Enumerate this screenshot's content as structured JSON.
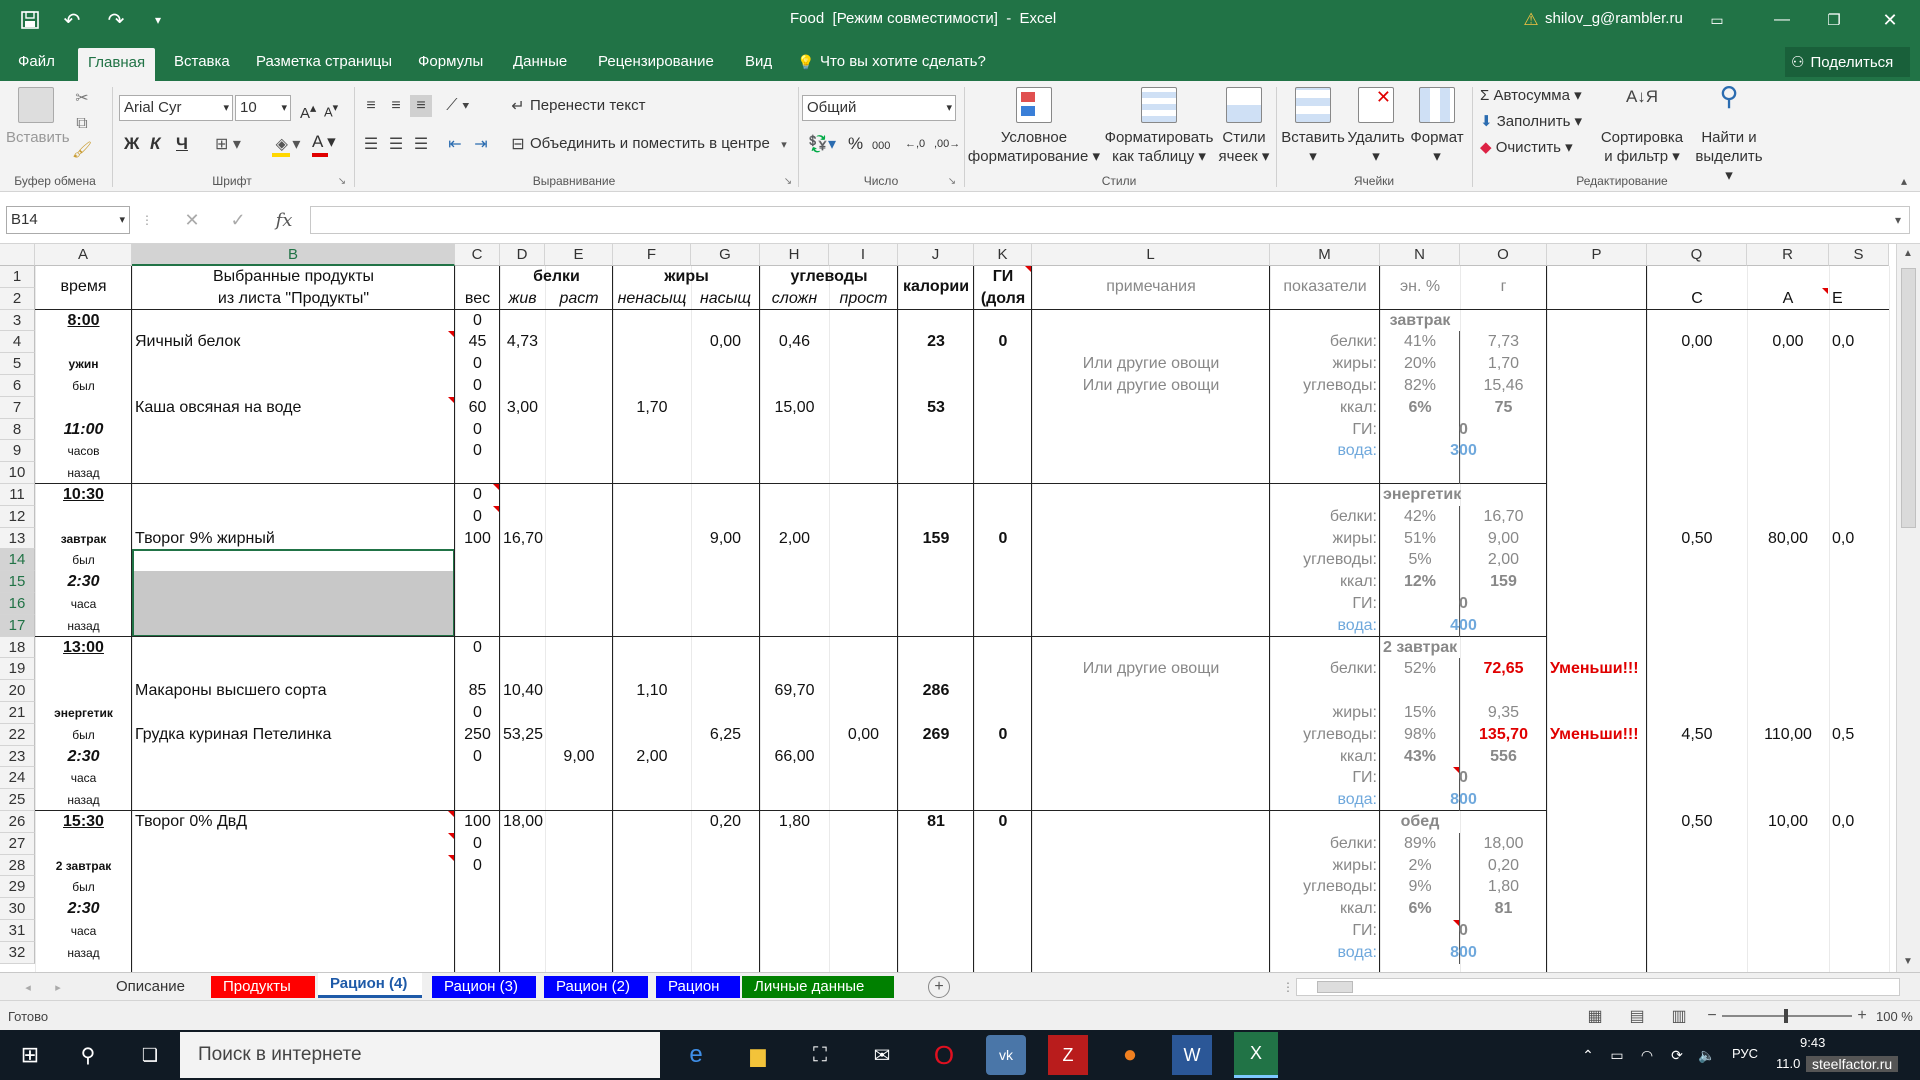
{
  "title": {
    "file": "Food  [Режим совместимости]  -  Excel",
    "user": "shilov_g@rambler.ru"
  },
  "tabs": [
    "Файл",
    "Главная",
    "Вставка",
    "Разметка страницы",
    "Формулы",
    "Данные",
    "Рецензирование",
    "Вид"
  ],
  "tell_me": "Что вы хотите сделать?",
  "share": "Поделиться",
  "ribbon": {
    "paste": "Вставить",
    "font_name": "Arial Cyr",
    "font_size": "10",
    "bold": "Ж",
    "italic": "К",
    "underline": "Ч",
    "wrap": "Перенести текст",
    "merge": "Объединить и поместить в центре",
    "num_format": "Общий",
    "cond1": "Условное",
    "cond2": "форматирование",
    "fmt1": "Форматировать",
    "fmt2": "как таблицу",
    "sty1": "Стили",
    "sty2": "ячеек",
    "ins": "Вставить",
    "del": "Удалить",
    "fmt": "Формат",
    "autosum": "Автосумма",
    "fill": "Заполнить",
    "clear": "Очистить",
    "sort1": "Сортировка",
    "sort2": "и фильтр",
    "find1": "Найти и",
    "find2": "выделить",
    "groups": [
      "Буфер обмена",
      "Шрифт",
      "Выравнивание",
      "Число",
      "Стили",
      "Ячейки",
      "Редактирование"
    ]
  },
  "namebox": "B14",
  "columns": [
    "A",
    "B",
    "C",
    "D",
    "E",
    "F",
    "G",
    "H",
    "I",
    "J",
    "K",
    "L",
    "M",
    "N",
    "O",
    "P",
    "Q",
    "R",
    "S"
  ],
  "rows": [
    "1",
    "2",
    "3",
    "4",
    "5",
    "6",
    "7",
    "8",
    "9",
    "10",
    "11",
    "12",
    "13",
    "14",
    "15",
    "16",
    "17",
    "18",
    "19",
    "20",
    "21",
    "22",
    "23",
    "24",
    "25",
    "26",
    "27",
    "28",
    "29",
    "30",
    "31",
    "32"
  ],
  "header": {
    "time": "время",
    "sel1": "Выбранные продукты",
    "sel2": "из листа \"Продукты\"",
    "weight": "вес",
    "prot": "белки",
    "prot_a": "жив",
    "prot_p": "раст",
    "fat": "жиры",
    "fat_u": "ненасыщ",
    "fat_s": "насыщ",
    "carb": "углеводы",
    "carb_c": "сложн",
    "carb_s": "прост",
    "cal": "калории",
    "gi1": "ГИ",
    "gi2": "(доля",
    "note": "примечания",
    "ind": "показатели",
    "en": "эн. %",
    "g": "г",
    "q": "С",
    "r": "А",
    "s": "Е"
  },
  "cells": {
    "a3": "8:00",
    "a5": "ужин",
    "a6": "был",
    "a8": "11:00",
    "a9": "часов",
    "a10": "назад",
    "a11": "10:30",
    "a13": "завтрак",
    "a14": "был",
    "a15": "2:30",
    "a16": "часа",
    "a17": "назад",
    "a18": "13:00",
    "a21": "энергетик",
    "a22": "был",
    "a23": "2:30",
    "a24": "часа",
    "a25": "назад",
    "a26": "15:30",
    "a28": "2 завтрак",
    "a29": "был",
    "a30": "2:30",
    "a31": "часа",
    "a32": "назад",
    "b4": "Яичный белок",
    "b7": "Каша овсяная на воде",
    "b13": "Творог 9% жирный",
    "b20": "Макароны высшего сорта",
    "b22": "Грудка куриная Петелинка",
    "b26": "Творог 0% ДвД",
    "c3": "0",
    "c4": "45",
    "c5": "0",
    "c6": "0",
    "c7": "60",
    "c8": "0",
    "c9": "0",
    "c11": "0",
    "c12": "0",
    "c13": "100",
    "c18": "0",
    "c20": "85",
    "c21": "0",
    "c22": "250",
    "c23": "0",
    "c26": "100",
    "c27": "0",
    "c28": "0",
    "d4": "4,73",
    "g4": "0,00",
    "h4": "0,46",
    "j4": "23",
    "k4": "0",
    "d7": "3,00",
    "f7": "1,70",
    "h7": "15,00",
    "j7": "53",
    "d13": "16,70",
    "g13": "9,00",
    "h13": "2,00",
    "j13": "159",
    "k13": "0",
    "d20": "10,40",
    "f20": "1,10",
    "h20": "69,70",
    "j20": "286",
    "d22": "53,25",
    "g22": "6,25",
    "i22": "0,00",
    "j22": "269",
    "k22": "0",
    "e23": "9,00",
    "f23": "2,00",
    "h23": "66,00",
    "d26": "18,00",
    "g26": "0,20",
    "h26": "1,80",
    "j26": "81",
    "k26": "0",
    "l5": "Или другие овощи",
    "l6": "Или другие овощи",
    "l19": "Или другие овощи",
    "q4": "0,00",
    "r4": "0,00",
    "s4": "0,0",
    "q13": "0,50",
    "r13": "80,00",
    "s13": "0,0",
    "q22": "4,50",
    "r22": "110,00",
    "s22": "0,5",
    "q26": "0,50",
    "r26": "10,00",
    "s26": "0,0"
  },
  "blocks": [
    {
      "name": "завтрак",
      "p": "41%",
      "pg": "7,73",
      "f": "20%",
      "fg": "1,70",
      "c": "82%",
      "cg": "15,46",
      "k": "6%",
      "kg": "75",
      "gi": "0",
      "w": "300"
    },
    {
      "name": "энергетик",
      "p": "42%",
      "pg": "16,70",
      "f": "51%",
      "fg": "9,00",
      "c": "5%",
      "cg": "2,00",
      "k": "12%",
      "kg": "159",
      "gi": "0",
      "w": "400"
    },
    {
      "name": "2 завтрак",
      "p": "52%",
      "pg": "72,65",
      "f": "15%",
      "fg": "9,35",
      "c": "98%",
      "cg": "135,70",
      "k": "43%",
      "kg": "556",
      "gi": "0",
      "w": "800"
    },
    {
      "name": "обед",
      "p": "89%",
      "pg": "18,00",
      "f": "2%",
      "fg": "0,20",
      "c": "9%",
      "cg": "1,80",
      "k": "6%",
      "kg": "81",
      "gi": "0",
      "w": "800"
    }
  ],
  "labels": {
    "prot": "белки:",
    "fat": "жиры:",
    "carb": "углеводы:",
    "kcal": "ккал:",
    "gi": "ГИ:",
    "water": "вода:",
    "warn": "Уменьши!!!"
  },
  "sheets": [
    "Описание",
    "Продукты",
    "Рацион (4)",
    "Рацион (3)",
    "Рацион (2)",
    "Рацион",
    "Личные данные"
  ],
  "status": {
    "ready": "Готово",
    "zoom": "100 %"
  },
  "taskbar": {
    "search": "Поиск в интернете",
    "lang": "РУС",
    "time": "9:43",
    "date": "11.0",
    "watermark": "steelfactor.ru"
  },
  "colors": {
    "excel_green": "#217346",
    "red_tab": "#ff0000",
    "blue_tab": "#0000ff",
    "green_tab": "#008000",
    "water": "#6fa8dc",
    "warn": "#e00000"
  }
}
